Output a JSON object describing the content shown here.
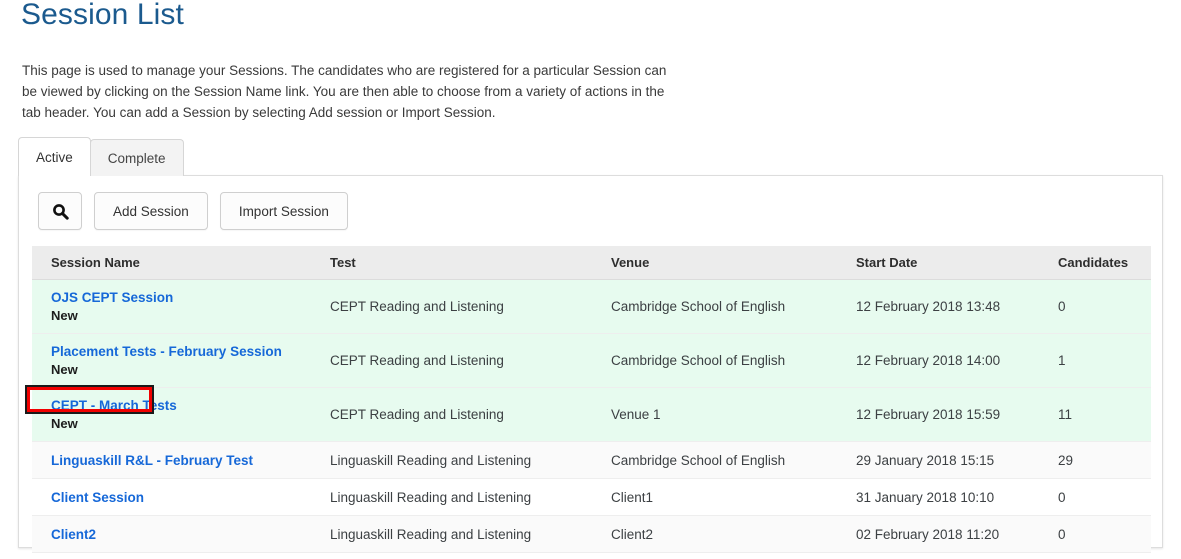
{
  "page": {
    "title": "Session List",
    "description": "This page is used to manage your Sessions. The candidates who are registered for a particular Session can be viewed by clicking on the Session Name link. You are then able to choose from a variety of actions in the tab header. You can add a Session by selecting Add session or Import Session."
  },
  "tabs": [
    {
      "label": "Active",
      "selected": true
    },
    {
      "label": "Complete",
      "selected": false
    }
  ],
  "toolbar": {
    "search_icon": "search-icon",
    "add_session_label": "Add Session",
    "import_session_label": "Import Session"
  },
  "table": {
    "columns": [
      "Session Name",
      "Test",
      "Venue",
      "Start Date",
      "Candidates"
    ],
    "rows": [
      {
        "name": "OJS CEPT Session",
        "status": "New",
        "test": "CEPT Reading and Listening",
        "venue": "Cambridge School of English",
        "start_date": "12 February 2018 13:48",
        "candidates": "0"
      },
      {
        "name": "Placement Tests - February Session",
        "status": "New",
        "test": "CEPT Reading and Listening",
        "venue": "Cambridge School of English",
        "start_date": "12 February 2018 14:00",
        "candidates": "1"
      },
      {
        "name": "CEPT - March Tests",
        "status": "New",
        "test": "CEPT Reading and Listening",
        "venue": "Venue 1",
        "start_date": "12 February 2018 15:59",
        "candidates": "11"
      },
      {
        "name": "Linguaskill R&L - February Test",
        "status": "",
        "test": "Linguaskill Reading and Listening",
        "venue": "Cambridge School of English",
        "start_date": "29 January 2018 15:15",
        "candidates": "29"
      },
      {
        "name": "Client Session",
        "status": "",
        "test": "Linguaskill Reading and Listening",
        "venue": "Client1",
        "start_date": "31 January 2018 10:10",
        "candidates": "0"
      },
      {
        "name": "Client2",
        "status": "",
        "test": "Linguaskill Reading and Listening",
        "venue": "Client2",
        "start_date": "02 February 2018 11:20",
        "candidates": "0"
      }
    ]
  },
  "annotation": {
    "highlight_target": "CEPT - March Tests",
    "border_color": "#f10000"
  },
  "colors": {
    "title": "#1b5a8e",
    "link": "#1668d8",
    "row_green": "#e7fbef",
    "row_grey": "#fafafa",
    "header_grey": "#ececec"
  }
}
